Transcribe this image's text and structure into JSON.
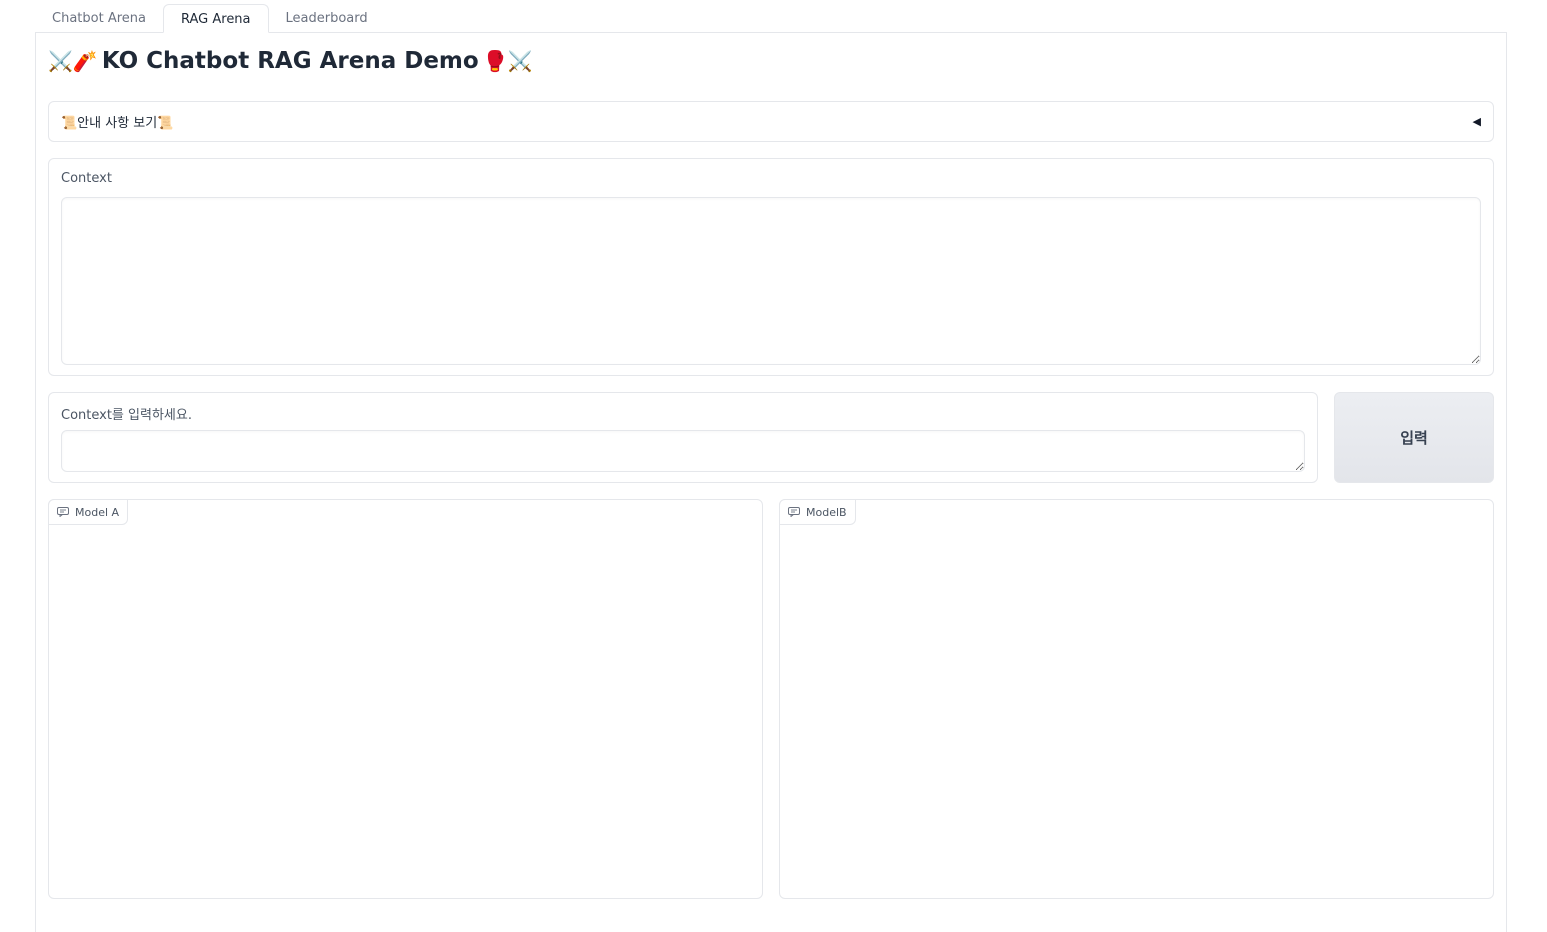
{
  "tabs": [
    {
      "label": "Chatbot Arena"
    },
    {
      "label": "RAG Arena",
      "active": true
    },
    {
      "label": "Leaderboard"
    }
  ],
  "header": {
    "emoji_left": "⚔️🧨",
    "title": "KO Chatbot RAG Arena Demo",
    "emoji_right": "🥊⚔️"
  },
  "accordion": {
    "label": "📜안내 사항 보기📜",
    "caret": "◀"
  },
  "context": {
    "label": "Context",
    "value": ""
  },
  "question": {
    "label": "Context를 입력하세요.",
    "value": ""
  },
  "submit_label": "입력",
  "chatbots": {
    "model_a": {
      "label": "Model A"
    },
    "model_b": {
      "label": "ModelB"
    }
  },
  "colors": {
    "border": "#e5e7eb",
    "button_bg": "#e5e7eb",
    "text": "#1f2937",
    "muted": "#6b7280"
  },
  "icons": {
    "chat": "chat-bubble-icon",
    "caret": "caret-left-icon"
  }
}
